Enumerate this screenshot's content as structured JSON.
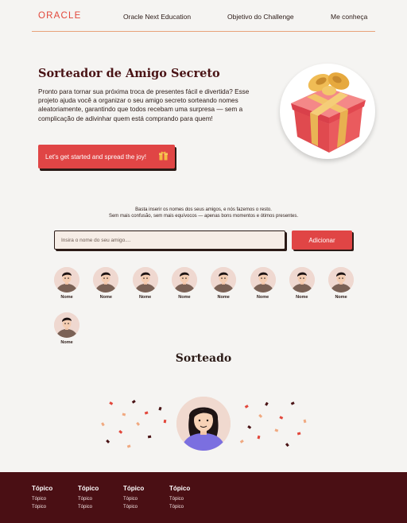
{
  "header": {
    "logo": "ORACLE",
    "nav": [
      "Oracle Next Education",
      "Objetivo do Challenge",
      "Me conheça"
    ]
  },
  "hero": {
    "title": "Sorteador de Amigo Secreto",
    "text": "Pronto para tornar sua próxima troca de presentes fácil e divertida? Esse projeto ajuda você a organizar o seu amigo secreto sorteando nomes aleatoriamente, garantindo que todos recebam uma surpresa — sem a complicação de adivinhar quem está comprando para quem!",
    "cta_label": "Let's get started and spread the joy!"
  },
  "instructions": {
    "line1": "Basta inserir os nomes dos seus amigos, e nós fazemos o resto.",
    "line2": "Sem mais confusão, sem mais equívocos — apenas bons momentos e ótimos presentes."
  },
  "form": {
    "placeholder": "Insira o nome do seu amigo....",
    "add_label": "Adicionar"
  },
  "friends": [
    "Nome",
    "Nome",
    "Nome",
    "Nome",
    "Nome",
    "Nome",
    "Nome",
    "Nome",
    "Nome"
  ],
  "result": {
    "title": "Sorteado"
  },
  "footer": {
    "columns": [
      {
        "heading": "Tópico",
        "links": [
          "Tópico",
          "Tópico"
        ]
      },
      {
        "heading": "Tópico",
        "links": [
          "Tópico",
          "Tópico"
        ]
      },
      {
        "heading": "Tópico",
        "links": [
          "Tópico",
          "Tópico"
        ]
      },
      {
        "heading": "Tópico",
        "links": [
          "Tópico",
          "Tópico"
        ]
      }
    ]
  },
  "colors": {
    "accent": "#e04545",
    "brand_red": "#e2473b",
    "title": "#4a1416",
    "footer_bg": "#4a0f14",
    "background": "#f5f4f2"
  },
  "icons": [
    "gift-icon",
    "friend-avatar-icon",
    "winner-avatar-icon",
    "confetti"
  ]
}
